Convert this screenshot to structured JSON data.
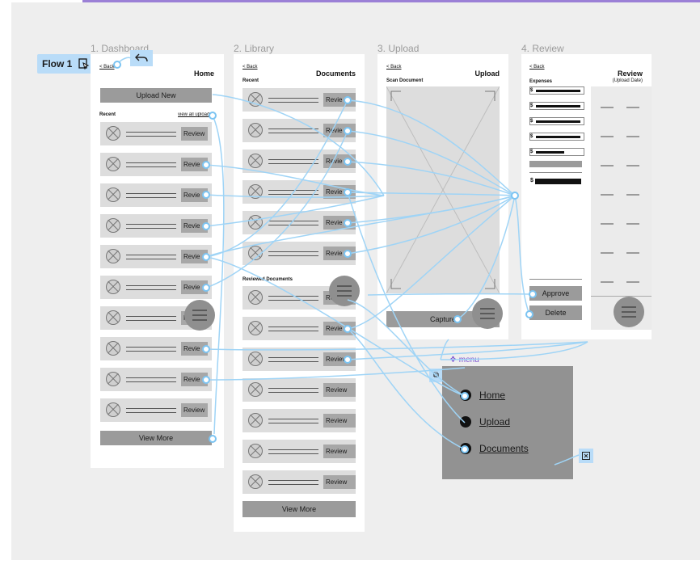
{
  "canvas": {
    "accent": "#9b80d6",
    "wire_color": "#7cc4f2"
  },
  "flow": {
    "label": "Flow 1",
    "icon": "flow-start-icon"
  },
  "frames": {
    "dashboard": {
      "title": "1. Dashboard",
      "back": "< Back",
      "header": "Home",
      "upload_button": "Upload New",
      "recent_label": "Recent",
      "view_all": "view all uploads",
      "rows": [
        "Review",
        "Revie",
        "Revie",
        "Revie",
        "Revie",
        "Revie",
        "Revie",
        "Revie",
        "Revie",
        "Review"
      ],
      "view_more": "View More"
    },
    "library": {
      "title": "2. Library",
      "back": "< Back",
      "header": "Documents",
      "recent_label": "Recent",
      "recent_rows": [
        "Revie",
        "Revie",
        "Revie",
        "Revie",
        "Revie",
        "Revie"
      ],
      "reviewed_label": "Reviewed Documents",
      "reviewed_rows": [
        "Review",
        "Revie",
        "Review",
        "Review",
        "Review",
        "Review",
        "Review"
      ],
      "view_more": "View More"
    },
    "upload": {
      "title": "3. Upload",
      "back": "< Back",
      "header": "Upload",
      "scan_label": "Scan Document",
      "capture_button": "Capture"
    },
    "review": {
      "title": "4. Review",
      "back": "< Back",
      "header": "Review",
      "subheader": "(Upload Date)",
      "expenses_label": "Expenses",
      "currency": "$",
      "approve_button": "Approve",
      "delete_button": "Delete"
    }
  },
  "menu": {
    "label": "menu",
    "items": [
      "Home",
      "Upload",
      "Documents"
    ],
    "close_icon": "close-icon"
  }
}
